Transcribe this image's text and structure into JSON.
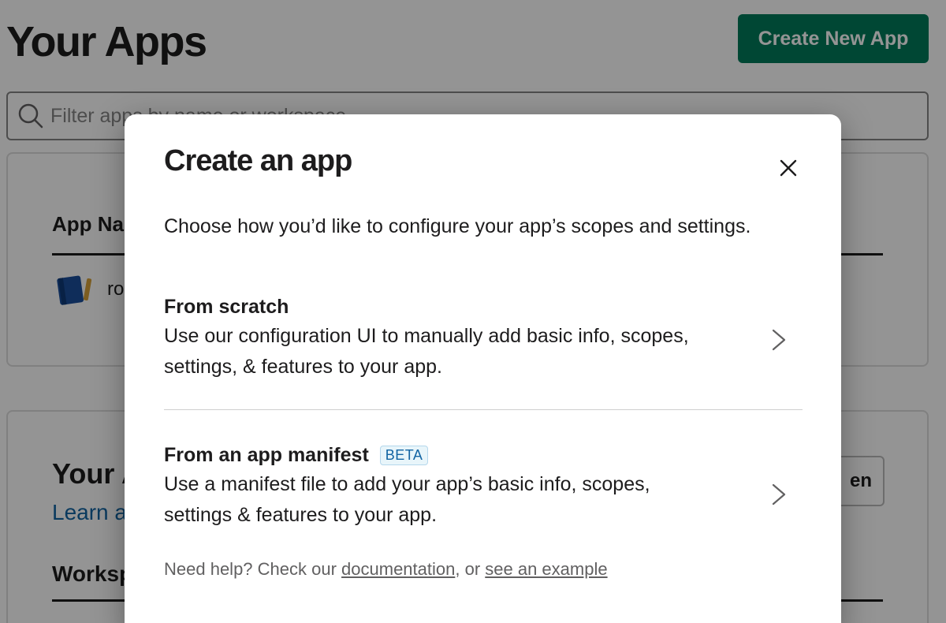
{
  "page": {
    "title": "Your Apps",
    "create_button": "Create New App",
    "filter_placeholder": "Filter apps by name or workspace",
    "apps_table": {
      "column_header": "App Na",
      "row_name": "ro"
    },
    "tokens_card": {
      "title": "Your A",
      "link": "Learn al",
      "button": "en",
      "column_header": "Worksp"
    }
  },
  "modal": {
    "title": "Create an app",
    "description": "Choose how you’d like to configure your app’s scopes and settings.",
    "options": [
      {
        "title": "From scratch",
        "description": "Use our configuration UI to manually add basic info, scopes, settings, & features to your app."
      },
      {
        "title": "From an app manifest",
        "badge": "BETA",
        "description": "Use a manifest file to add your app’s basic info, scopes, settings & features to your app."
      }
    ],
    "help": {
      "prefix": "Need help? Check our ",
      "doc_link": "documentation",
      "middle": ", or ",
      "example_link": "see an example"
    }
  },
  "colors": {
    "primary_button": "#007a5a",
    "link": "#1264a3",
    "badge_bg": "#e8f5fa",
    "overlay": "rgba(0,0,0,0.42)"
  },
  "icons": [
    "search-icon",
    "app-book-icon",
    "close-icon",
    "chevron-right-icon"
  ]
}
